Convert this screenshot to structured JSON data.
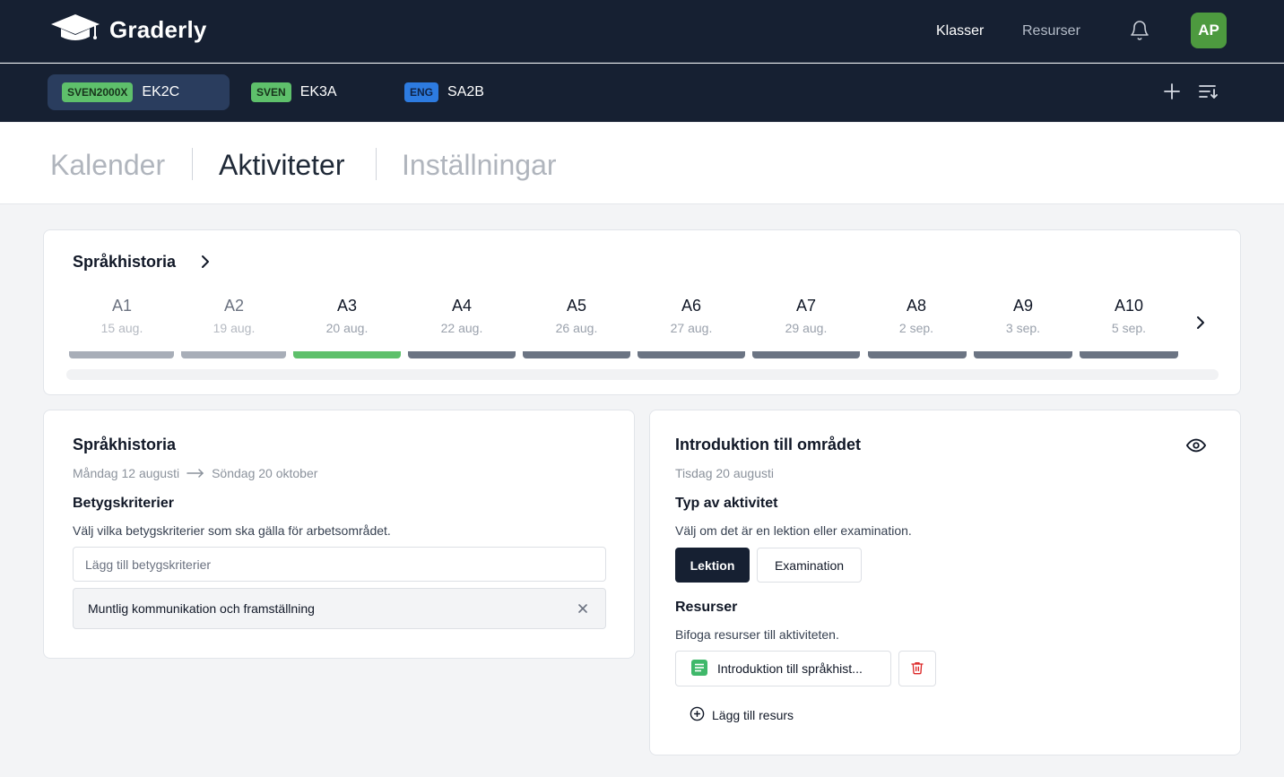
{
  "app": {
    "name": "Graderly"
  },
  "nav": {
    "klasser": "Klasser",
    "resurser": "Resurser",
    "avatar": "AP",
    "icons": [
      "graduation-cap-icon",
      "bell-icon"
    ]
  },
  "classes": [
    {
      "subject": "SVEN2000X",
      "name": "EK2C",
      "color": "#5ec06b",
      "active": true
    },
    {
      "subject": "SVEN",
      "name": "EK3A",
      "color": "#5ec06b",
      "active": false
    },
    {
      "subject": "ENG",
      "name": "SA2B",
      "color": "#2d7be0",
      "active": false
    }
  ],
  "page_tabs": [
    {
      "label": "Kalender",
      "active": false
    },
    {
      "label": "Aktiviteter",
      "active": true
    },
    {
      "label": "Inställningar",
      "active": false
    }
  ],
  "timeline": {
    "title": "Språkhistoria",
    "activities": [
      {
        "code": "A1",
        "date": "15 aug.",
        "status": "past"
      },
      {
        "code": "A2",
        "date": "19 aug.",
        "status": "past"
      },
      {
        "code": "A3",
        "date": "20 aug.",
        "status": "selected"
      },
      {
        "code": "A4",
        "date": "22 aug.",
        "status": "upcoming"
      },
      {
        "code": "A5",
        "date": "26 aug.",
        "status": "upcoming"
      },
      {
        "code": "A6",
        "date": "27 aug.",
        "status": "upcoming"
      },
      {
        "code": "A7",
        "date": "29 aug.",
        "status": "upcoming"
      },
      {
        "code": "A8",
        "date": "2 sep.",
        "status": "upcoming"
      },
      {
        "code": "A9",
        "date": "3 sep.",
        "status": "upcoming"
      },
      {
        "code": "A10",
        "date": "5 sep.",
        "status": "upcoming"
      }
    ],
    "colors": {
      "past": "#a8aeb8",
      "selected": "#5ec06b",
      "upcoming": "#6b7483"
    }
  },
  "area": {
    "title": "Språkhistoria",
    "start": "Måndag 12 augusti",
    "end": "Söndag 20 oktober",
    "criteria_title": "Betygskriterier",
    "criteria_desc": "Välj vilka betygskriterier som ska gälla för arbetsområdet.",
    "criteria_placeholder": "Lägg till betygskriterier",
    "criteria_selected": [
      "Muntlig kommunikation och framställning"
    ]
  },
  "activity": {
    "title": "Introduktion till området",
    "date": "Tisdag 20 augusti",
    "type_title": "Typ av aktivitet",
    "type_desc": "Välj om det är en lektion eller examination.",
    "type_options": [
      "Lektion",
      "Examination"
    ],
    "type_selected": "Lektion",
    "resources_title": "Resurser",
    "resources_desc": "Bifoga resurser till aktiviteten.",
    "resources": [
      "Introduktion till språkhist..."
    ],
    "add_resource": "Lägg till resurs"
  }
}
